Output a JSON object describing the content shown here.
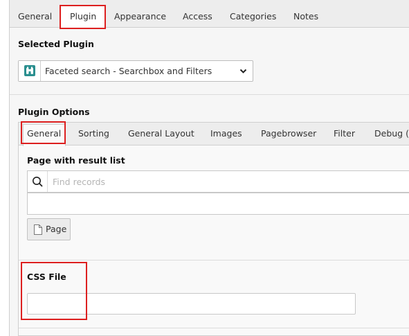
{
  "top_tabs": [
    "General",
    "Plugin",
    "Appearance",
    "Access",
    "Categories",
    "Notes"
  ],
  "active_top_tab": "Plugin",
  "selected_plugin": {
    "heading": "Selected Plugin",
    "value": "Faceted search - Searchbox and Filters",
    "icon": "binoculars-icon"
  },
  "plugin_options": {
    "heading": "Plugin Options",
    "tabs": [
      "General",
      "Sorting",
      "General Layout",
      "Images",
      "Pagebrowser",
      "Filter",
      "Debug (A"
    ],
    "active_tab": "General",
    "result_list": {
      "label": "Page with result list",
      "search_placeholder": "Find records",
      "search_value": "",
      "page_button_label": "Page"
    },
    "css_file": {
      "label": "CSS File",
      "value": ""
    }
  },
  "colors": {
    "highlight": "#dd1f1f",
    "plugin_icon_bg": "#2b8f8f",
    "tab_bar_bg": "#ededed",
    "panel_bg": "#f6f6f6"
  }
}
